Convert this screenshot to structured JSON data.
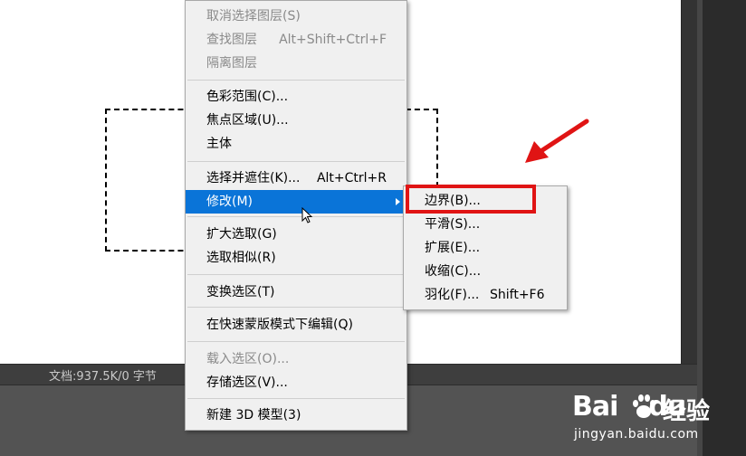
{
  "status_bar": {
    "doc_info": "文档:937.5K/0 字节"
  },
  "menu": {
    "items": [
      {
        "label": "取消选择图层(S)",
        "shortcut": "",
        "state": "disabled"
      },
      {
        "label": "查找图层",
        "shortcut": "Alt+Shift+Ctrl+F",
        "state": "disabled"
      },
      {
        "label": "隔离图层",
        "shortcut": "",
        "state": "disabled"
      },
      {
        "label": "色彩范围(C)...",
        "shortcut": "",
        "state": "enabled"
      },
      {
        "label": "焦点区域(U)...",
        "shortcut": "",
        "state": "enabled"
      },
      {
        "label": "主体",
        "shortcut": "",
        "state": "enabled"
      },
      {
        "label": "选择并遮住(K)...",
        "shortcut": "Alt+Ctrl+R",
        "state": "enabled"
      },
      {
        "label": "修改(M)",
        "shortcut": "",
        "state": "highlighted"
      },
      {
        "label": "扩大选取(G)",
        "shortcut": "",
        "state": "enabled"
      },
      {
        "label": "选取相似(R)",
        "shortcut": "",
        "state": "enabled"
      },
      {
        "label": "变换选区(T)",
        "shortcut": "",
        "state": "enabled"
      },
      {
        "label": "在快速蒙版模式下编辑(Q)",
        "shortcut": "",
        "state": "enabled"
      },
      {
        "label": "载入选区(O)...",
        "shortcut": "",
        "state": "disabled"
      },
      {
        "label": "存储选区(V)...",
        "shortcut": "",
        "state": "enabled"
      },
      {
        "label": "新建 3D 模型(3)",
        "shortcut": "",
        "state": "enabled"
      }
    ]
  },
  "submenu": {
    "items": [
      {
        "label": "边界(B)...",
        "shortcut": ""
      },
      {
        "label": "平滑(S)...",
        "shortcut": ""
      },
      {
        "label": "扩展(E)...",
        "shortcut": ""
      },
      {
        "label": "收缩(C)...",
        "shortcut": ""
      },
      {
        "label": "羽化(F)...",
        "shortcut": "Shift+F6"
      }
    ]
  },
  "watermark": {
    "logo_bai": "Bai",
    "logo_du": "du",
    "cn": "经验",
    "url": "jingyan.baidu.com"
  },
  "colors": {
    "highlight": "#0a74d8",
    "annotation": "#e01414",
    "menu_bg": "#f0f0f0"
  }
}
